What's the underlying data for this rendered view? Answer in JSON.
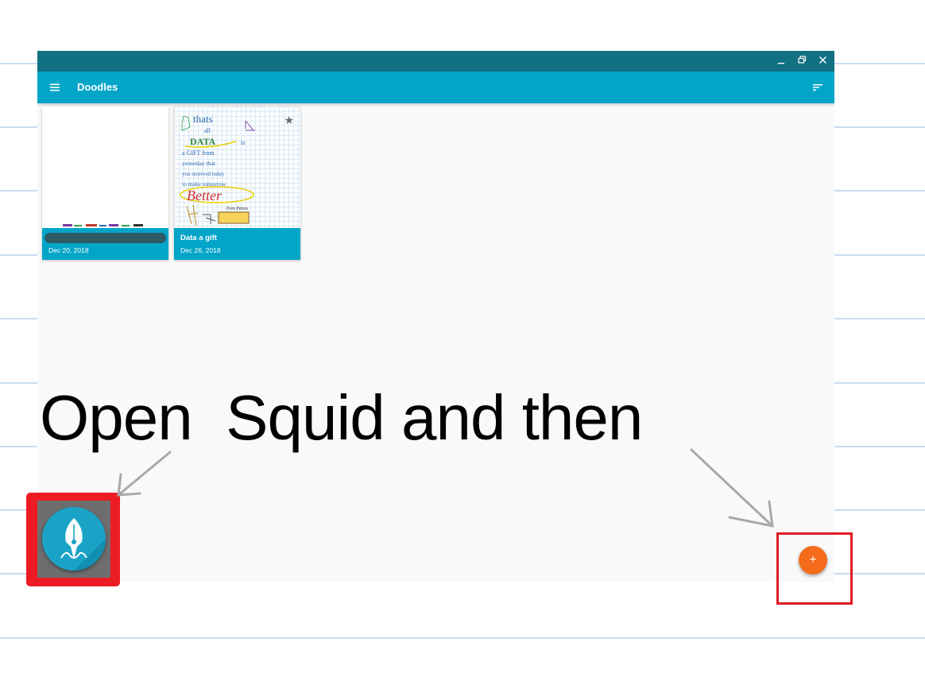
{
  "window": {
    "title_bar_buttons": [
      "minimize",
      "restore",
      "close"
    ]
  },
  "appbar": {
    "title": "Doodles",
    "menu_icon": "hamburger-menu-icon",
    "sort_icon": "sort-icon"
  },
  "notes": [
    {
      "title": "",
      "title_redacted": true,
      "date": "Dec 20, 2018",
      "starred": false
    },
    {
      "title": "Data a gift",
      "date": "Dec 26, 2018",
      "starred": true,
      "thumbnail_text": [
        "thats",
        "all",
        "DATA",
        "is",
        "a GIFT from",
        "yesterday that",
        "you received today",
        "to make tomorrow",
        "Better",
        "-Tom Peters"
      ]
    }
  ],
  "fab": {
    "label": "+",
    "color": "#f46b1c"
  },
  "instruction": {
    "text": "Open  Squid and then"
  },
  "colors": {
    "titlebar": "#117082",
    "appbar": "#00a5c8",
    "highlight": "#ed1c24",
    "ruled_line": "#c9dcf3"
  }
}
